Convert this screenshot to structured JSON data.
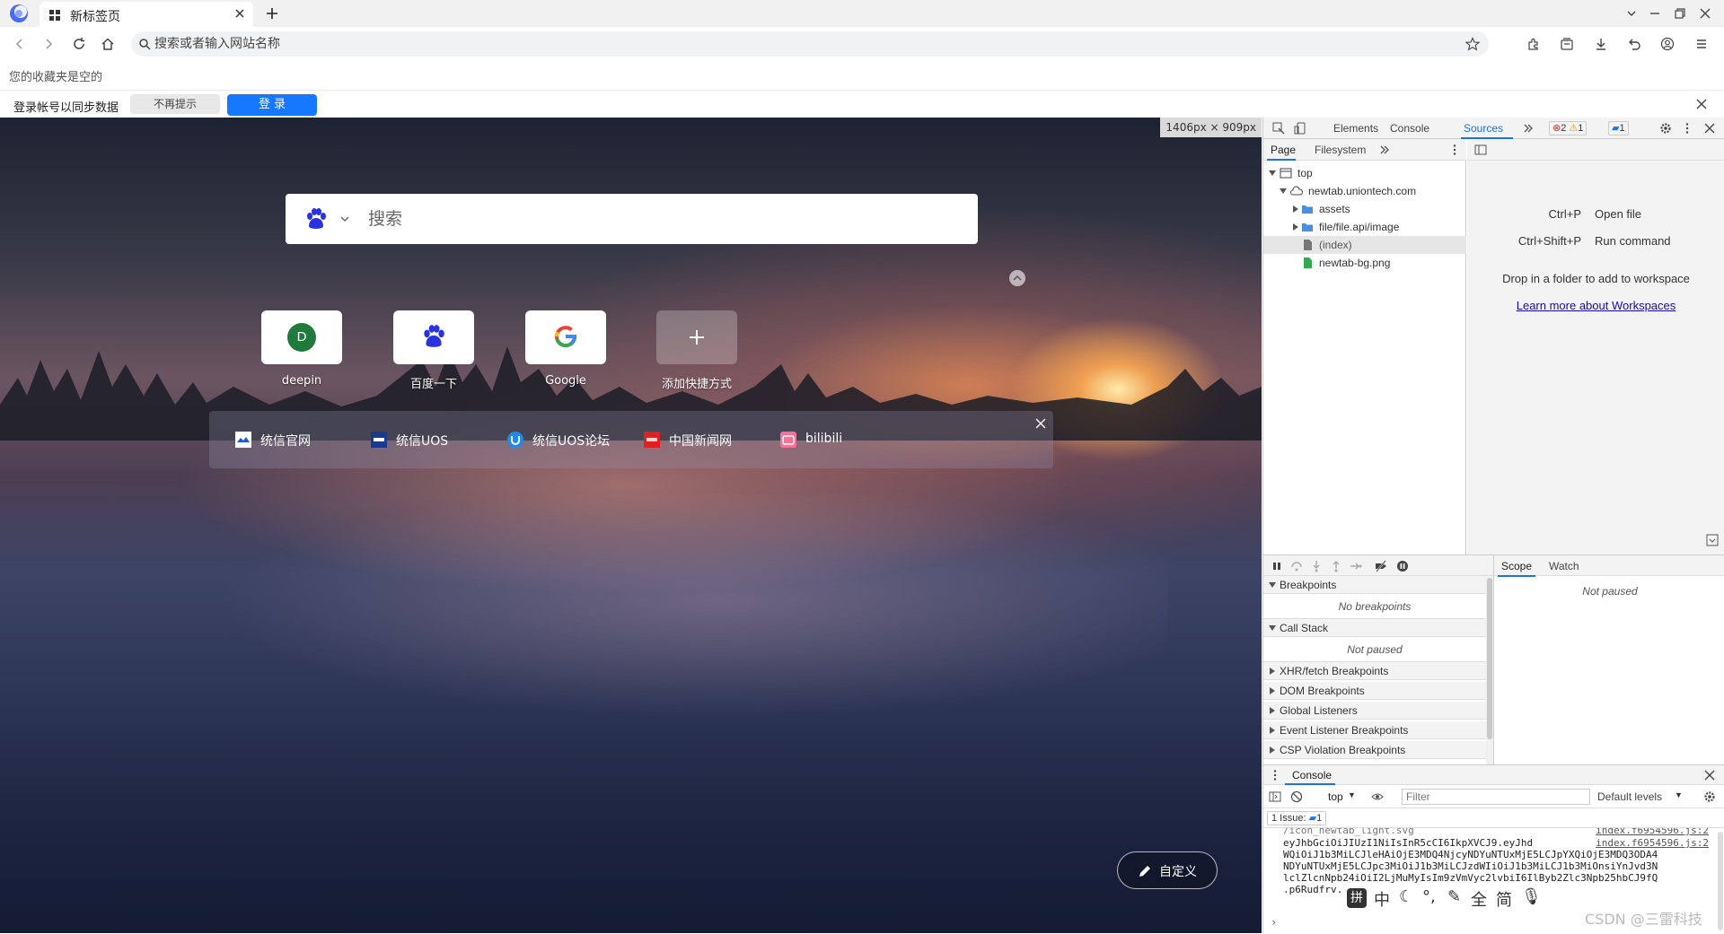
{
  "window": {
    "tab_title": "新标签页",
    "address_placeholder": "搜索或者输入网站名称"
  },
  "bookmarks_bar": {
    "empty_text": "您的收藏夹是空的"
  },
  "sync_bar": {
    "text": "登录帐号以同步数据",
    "dont_remind": "不再提示",
    "login": "登 录"
  },
  "viewport": {
    "size_badge": "1406px × 909px"
  },
  "newtab": {
    "search_placeholder": "搜索",
    "shortcuts": [
      {
        "label": "deepin",
        "avatar": "D",
        "icon": "avatar-letter"
      },
      {
        "label": "百度一下",
        "icon": "baidu-paw-icon"
      },
      {
        "label": "Google",
        "icon": "google-g-icon"
      },
      {
        "label": "添加快捷方式",
        "icon": "plus-icon"
      }
    ],
    "quick_links": [
      {
        "label": "统信官网",
        "icon": "uniontech-site-icon"
      },
      {
        "label": "统信UOS",
        "icon": "uos-icon"
      },
      {
        "label": "统信UOS论坛",
        "icon": "uos-forum-icon"
      },
      {
        "label": "中国新闻网",
        "icon": "chinanews-icon"
      },
      {
        "label": "bilibili",
        "icon": "bilibili-icon"
      }
    ],
    "customize": "自定义"
  },
  "devtools": {
    "tabs": [
      "Elements",
      "Console",
      "Sources"
    ],
    "active_tab": "Sources",
    "error_count": "2",
    "warning_count": "1",
    "message_count": "1",
    "navigator_tabs": [
      "Page",
      "Filesystem"
    ],
    "tree": {
      "root": "top",
      "domain": "newtab.uniontech.com",
      "folders": [
        "assets",
        "file/file.api/image"
      ],
      "files": [
        "(index)",
        "newtab-bg.png"
      ]
    },
    "editor_hints": [
      {
        "key": "Ctrl+P",
        "action": "Open file"
      },
      {
        "key": "Ctrl+Shift+P",
        "action": "Run command"
      }
    ],
    "workspace_text": "Drop in a folder to add to workspace",
    "workspace_link": "Learn more about Workspaces",
    "scope_tabs": [
      "Scope",
      "Watch"
    ],
    "scope_not_paused": "Not paused",
    "sections": {
      "breakpoints": "Breakpoints",
      "no_breakpoints": "No breakpoints",
      "call_stack": "Call Stack",
      "call_stack_empty": "Not paused",
      "xhr": "XHR/fetch Breakpoints",
      "dom": "DOM Breakpoints",
      "global": "Global Listeners",
      "event": "Event Listener Breakpoints",
      "csp": "CSP Violation Breakpoints"
    },
    "console": {
      "title": "Console",
      "context": "top",
      "filter_placeholder": "Filter",
      "levels": "Default levels",
      "issues_label": "1 Issue:",
      "issues_count": "1",
      "lines": [
        "/icon_newtab_light.svg",
        "eyJhbGciOiJIUzI1NiIsInR5cCI6IkpXVCJ9.eyJhd",
        "WQiOiJ1b3MiLCJleHAiOjE3MDQ4NjcyNDYuNTUxMjE5LCJpYXQiOjE3MDQ3ODA4",
        "NDYuNTUxMjE5LCJpc3MiOiJ1b3MiLCJzdWIiOiJ1b3MiLCJ1b3MiOnsiYnJvd3N",
        "lclZlcnNpb24iOiI2LjMuMyIsIm9zVmVyc2lvbiI6IlByb2Zlc3Npb25hbCJ9fQ",
        ".p6Rudfrv...90"
      ],
      "sources": [
        "index.f6954596.js:2",
        "index.f6954596.js:2"
      ]
    }
  },
  "ime": {
    "items": [
      "中",
      "°,",
      "全",
      "简"
    ]
  },
  "watermark": "CSDN @三雷科技"
}
